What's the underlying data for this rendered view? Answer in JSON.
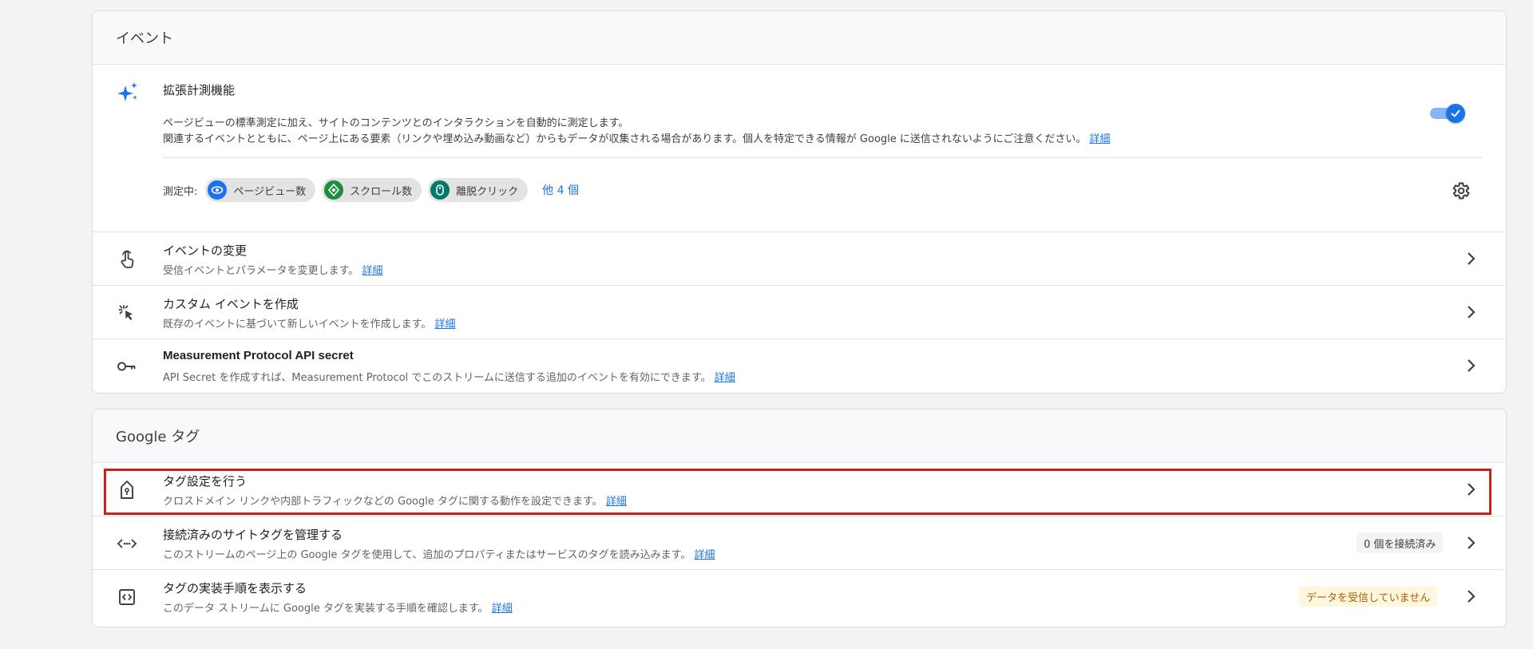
{
  "events": {
    "header": "イベント",
    "enhanced": {
      "title": "拡張計測機能",
      "desc_line1": "ページビューの標準測定に加え、サイトのコンテンツとのインタラクションを自動的に測定します。",
      "desc_line2": "関連するイベントとともに、ページ上にある要素（リンクや埋め込み動画など）からもデータが収集される場合があります。個人を特定できる情報が Google に送信されないようにご注意ください。",
      "link": "詳細",
      "toggle_on": true,
      "measuring_label": "測定中:",
      "chips": [
        {
          "label": "ページビュー数",
          "color": "#1a73e8"
        },
        {
          "label": "スクロール数",
          "color": "#1e8e3e"
        },
        {
          "label": "離脱クリック",
          "color": "#00796b"
        }
      ],
      "more": "他 4 個"
    },
    "rows": [
      {
        "title": "イベントの変更",
        "desc": "受信イベントとパラメータを変更します。",
        "link": "詳細"
      },
      {
        "title": "カスタム イベントを作成",
        "desc": "既存のイベントに基づいて新しいイベントを作成します。",
        "link": "詳細"
      },
      {
        "title": "Measurement Protocol API secret",
        "desc": "API Secret を作成すれば、Measurement Protocol でこのストリームに送信する追加のイベントを有効にできます。",
        "link": "詳細"
      }
    ]
  },
  "gtag": {
    "header": "Google タグ",
    "rows": [
      {
        "title": "タグ設定を行う",
        "desc": "クロスドメイン リンクや内部トラフィックなどの Google タグに関する動作を設定できます。",
        "link": "詳細"
      },
      {
        "title": "接続済みのサイトタグを管理する",
        "desc": "このストリームのページ上の Google タグを使用して、追加のプロパティまたはサービスのタグを読み込みます。",
        "link": "詳細",
        "badge": "0 個を接続済み"
      },
      {
        "title": "タグの実装手順を表示する",
        "desc": "このデータ ストリームに Google タグを実装する手順を確認します。",
        "link": "詳細",
        "badge": "データを受信していません"
      }
    ]
  }
}
